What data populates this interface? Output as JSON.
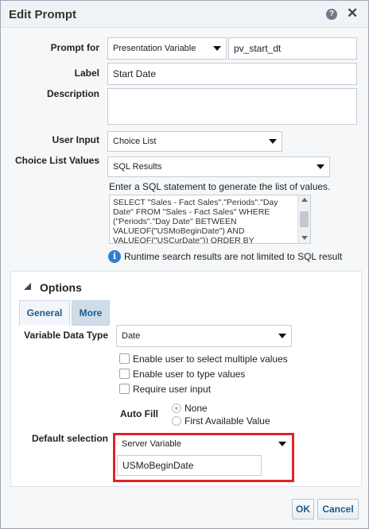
{
  "dialog": {
    "title": "Edit Prompt",
    "help_icon_glyph": "?",
    "close_icon_glyph": "✕"
  },
  "form": {
    "prompt_for_label": "Prompt for",
    "prompt_for_value": "Presentation Variable",
    "variable_name": "pv_start_dt",
    "label_label": "Label",
    "label_value": "Start Date",
    "description_label": "Description",
    "description_value": "",
    "user_input_label": "User Input",
    "user_input_value": "Choice List",
    "choice_list_values_label": "Choice List Values",
    "choice_list_values_value": "SQL Results",
    "sql_hint": "Enter a SQL statement to generate the list of values.",
    "sql_statement": "SELECT    \"Sales - Fact Sales\".\"Periods\".\"Day Date\" FROM \"Sales - Fact Sales\" WHERE (\"Periods\".\"Day Date\" BETWEEN VALUEOF(\"USMoBeginDate\") AND VALUEOF(\"USCurDate\")) ORDER BY \"Periods\".\"Day Date\"",
    "info_icon_glyph": "i",
    "runtime_note": "Runtime search results are not limited to SQL result"
  },
  "options": {
    "title": "Options",
    "tabs": [
      {
        "label": "General"
      },
      {
        "label": "More"
      }
    ],
    "variable_data_type_label": "Variable Data Type",
    "variable_data_type_value": "Date",
    "checkboxes": [
      {
        "label": "Enable user to select multiple values",
        "checked": false
      },
      {
        "label": "Enable user to type values",
        "checked": false
      },
      {
        "label": "Require user input",
        "checked": false
      }
    ],
    "auto_fill_label": "Auto Fill",
    "auto_fill_options": [
      {
        "label": "None",
        "selected": true
      },
      {
        "label": "First Available Value",
        "selected": false
      }
    ],
    "default_selection_label": "Default selection",
    "default_selection_value": "Server Variable",
    "default_selection_variable": "USMoBeginDate"
  },
  "buttons": {
    "ok": "OK",
    "cancel": "Cancel"
  },
  "colors": {
    "highlight_border": "#e02424",
    "tab_text": "#1f5a8a",
    "info_icon": "#2f7fd1"
  },
  "icons": {
    "help": "help-icon",
    "close": "close-icon",
    "info": "info-icon",
    "collapse": "triangle-collapse-icon",
    "dropdown": "chevron-down-icon"
  }
}
